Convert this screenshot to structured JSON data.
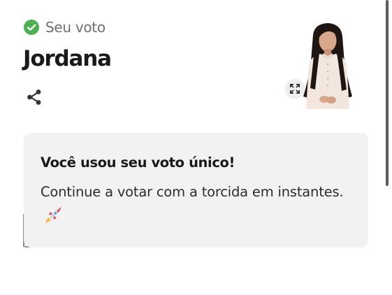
{
  "vote": {
    "status_label": "Seu voto",
    "status_icon": "check-circle-icon",
    "status_color": "#4caf50"
  },
  "candidate": {
    "name": "Jordana",
    "photo": "candidate-photo"
  },
  "actions": {
    "share_icon": "share-icon",
    "expand_icon": "expand-icon"
  },
  "message": {
    "title": "Você usou seu voto único!",
    "body": "Continue a votar com a torcida em instantes.",
    "emoji_icon": "rocket-icon"
  }
}
